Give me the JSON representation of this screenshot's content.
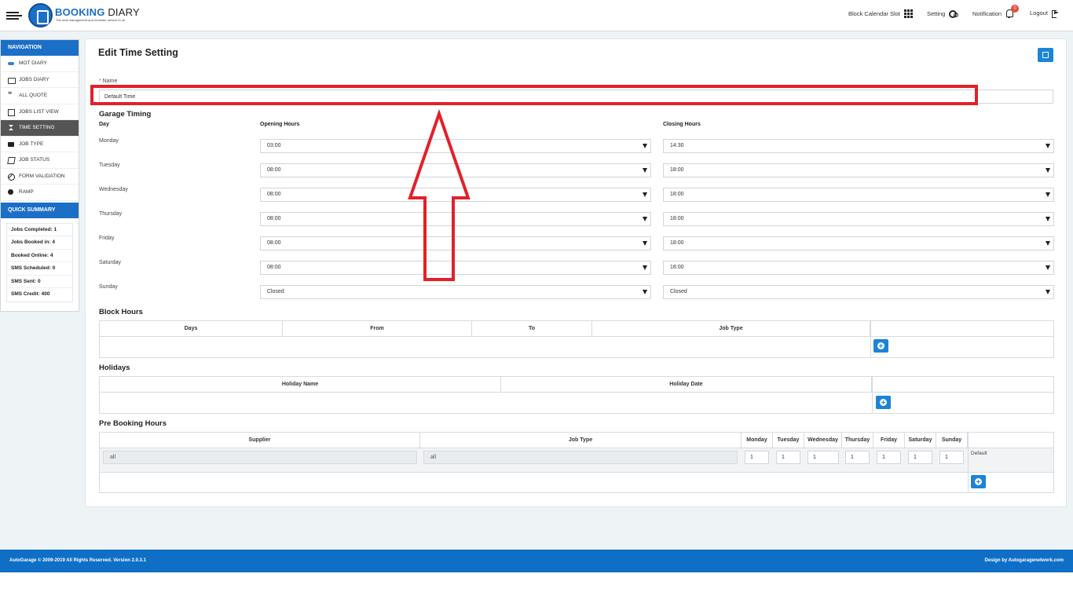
{
  "header": {
    "logo_main": "BOOKING",
    "logo_sub": " DIARY",
    "logo_tagline": "The best management and reminder service in uk",
    "links": {
      "block_calendar": "Block Calendar Slot",
      "setting": "Setting",
      "notification": "Notification",
      "logout": "Logout"
    },
    "notification_count": "0"
  },
  "sidebar": {
    "nav_title": "NAVIGATION",
    "items": [
      {
        "label": "MOT DIARY",
        "icon": "car-icon"
      },
      {
        "label": "JOBS DIARY",
        "icon": "folder-icon"
      },
      {
        "label": "ALL QUOTE",
        "icon": "quote-icon"
      },
      {
        "label": "JOBS LIST VIEW",
        "icon": "calendar-icon"
      },
      {
        "label": "TIME SETTING",
        "icon": "hourglass-icon"
      },
      {
        "label": "JOB TYPE",
        "icon": "briefcase-icon"
      },
      {
        "label": "JOB STATUS",
        "icon": "edit-icon"
      },
      {
        "label": "FORM VALIDATION",
        "icon": "ban-icon"
      },
      {
        "label": "RAMP",
        "icon": "dashboard-icon"
      }
    ],
    "summary_title": "QUICK SUMMARY",
    "summary": [
      "Jobs Completed: 1",
      "Jobs Booked in: 4",
      "Booked Online: 4",
      "SMS Scheduled: 0",
      "SMS Sent: 0",
      "SMS Credit: 400"
    ]
  },
  "form": {
    "title": "Edit Time Setting",
    "name_label_req": "*",
    "name_label": " Name",
    "name_value": "Default Time",
    "garage_timing_title": "Garage Timing",
    "col_day": "Day",
    "col_opening": "Opening Hours",
    "col_closing": "Closing Hours",
    "days": [
      {
        "day": "Monday",
        "open": "03:00",
        "close": "14:30"
      },
      {
        "day": "Tuesday",
        "open": "08:00",
        "close": "18:00"
      },
      {
        "day": "Wednesday",
        "open": "08:00",
        "close": "18:00"
      },
      {
        "day": "Thursday",
        "open": "08:00",
        "close": "18:00"
      },
      {
        "day": "Friday",
        "open": "08:00",
        "close": "18:00"
      },
      {
        "day": "Saturday",
        "open": "08:00",
        "close": "18:00"
      },
      {
        "day": "Sunday",
        "open": "Closed",
        "close": "Closed"
      }
    ],
    "block_hours_title": "Block Hours",
    "block_cols": [
      "Days",
      "From",
      "To",
      "Job Type"
    ],
    "holidays_title": "Holidays",
    "holiday_cols": [
      "Holiday Name",
      "Holiday Date"
    ],
    "pre_booking_title": "Pre Booking Hours",
    "pre_cols": [
      "Supplier",
      "Job Type",
      "Monday",
      "Tuesday",
      "Wednesday",
      "Thursday",
      "Friday",
      "Saturday",
      "Sunday"
    ],
    "pre_row": {
      "supplier": "all",
      "job_type": "all",
      "values": [
        "1",
        "1",
        "1",
        "1",
        "1",
        "1",
        "1"
      ],
      "note": "Default"
    }
  },
  "footer": {
    "left": "AutoGarage © 2009-2019 All Rights Reserved. Version 2.0.3.1",
    "right": "Design by Autogaragenetwork.com"
  },
  "colors": {
    "brand": "#1c6fc6",
    "button": "#1c84d8",
    "annotation": "#e3202a"
  }
}
